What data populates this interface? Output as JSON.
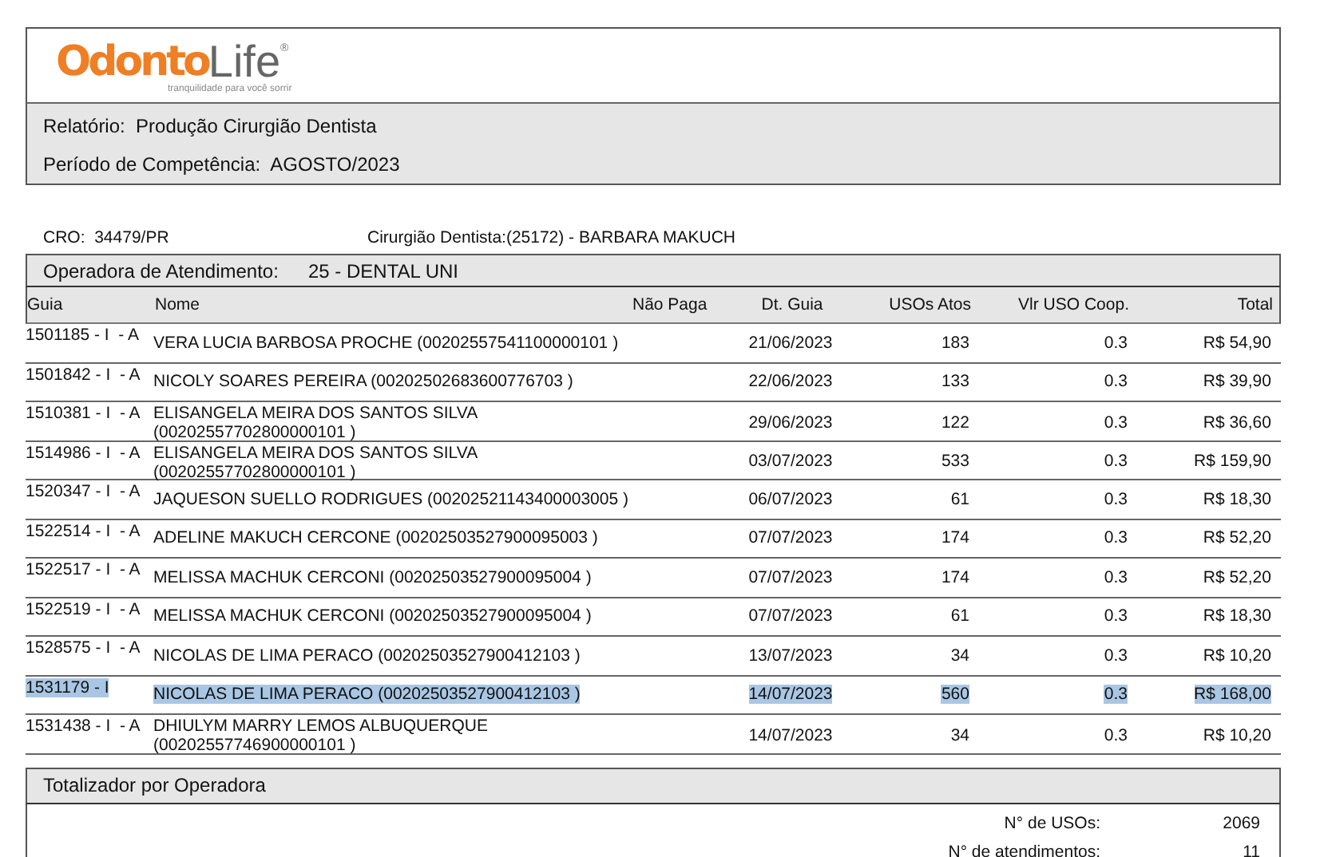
{
  "logo": {
    "brand_main": "Odonto",
    "brand_accent": "Life",
    "registered": "®",
    "tagline": "tranquilidade para você sorrir"
  },
  "header": {
    "report_label": "Relatório:",
    "report_value": "Produção Cirurgião Dentista",
    "period_label": "Período de Competência:",
    "period_value": "AGOSTO/2023"
  },
  "info": {
    "cro_label": "CRO:",
    "cro_value": "34479/PR",
    "dentist_label": "Cirurgião Dentista:",
    "dentist_value": "(25172) - BARBARA MAKUCH"
  },
  "operator": {
    "label": "Operadora de Atendimento:",
    "value": "25 - DENTAL UNI"
  },
  "table": {
    "columns": [
      "Guia",
      "Nome",
      "Não Paga",
      "Dt. Guia",
      "USOs Atos",
      "Vlr USO Coop.",
      "Total"
    ],
    "rows": [
      {
        "guia": "1501185 - I  - A",
        "nome": "VERA LUCIA BARBOSA PROCHE (00202557541100000101 )",
        "data": "21/06/2023",
        "usos": "183",
        "vlr": "0.3",
        "total": "R$ 54,90",
        "selected": false
      },
      {
        "guia": "1501842 - I  - A",
        "nome": "NICOLY SOARES PEREIRA (00202502683600776703 )",
        "data": "22/06/2023",
        "usos": "133",
        "vlr": "0.3",
        "total": "R$ 39,90",
        "selected": false
      },
      {
        "guia": "1510381 - I  - A",
        "nome": "ELISANGELA MEIRA DOS SANTOS SILVA (00202557702800000101 )",
        "data": "29/06/2023",
        "usos": "122",
        "vlr": "0.3",
        "total": "R$ 36,60",
        "selected": false
      },
      {
        "guia": "1514986 - I  - A",
        "nome": "ELISANGELA MEIRA DOS SANTOS SILVA (00202557702800000101 )",
        "data": "03/07/2023",
        "usos": "533",
        "vlr": "0.3",
        "total": "R$ 159,90",
        "selected": false
      },
      {
        "guia": "1520347 - I  - A",
        "nome": "JAQUESON SUELLO RODRIGUES (00202521143400003005 )",
        "data": "06/07/2023",
        "usos": "61",
        "vlr": "0.3",
        "total": "R$ 18,30",
        "selected": false
      },
      {
        "guia": "1522514 - I  - A",
        "nome": "ADELINE MAKUCH CERCONE (00202503527900095003 )",
        "data": "07/07/2023",
        "usos": "174",
        "vlr": "0.3",
        "total": "R$ 52,20",
        "selected": false
      },
      {
        "guia": "1522517 - I  - A",
        "nome": "MELISSA MACHUK CERCONI (00202503527900095004 )",
        "data": "07/07/2023",
        "usos": "174",
        "vlr": "0.3",
        "total": "R$ 52,20",
        "selected": false
      },
      {
        "guia": "1522519 - I  - A",
        "nome": "MELISSA MACHUK CERCONI (00202503527900095004 )",
        "data": "07/07/2023",
        "usos": "61",
        "vlr": "0.3",
        "total": "R$ 18,30",
        "selected": false
      },
      {
        "guia": "1528575 - I  - A",
        "nome": "NICOLAS DE LIMA PERACO (00202503527900412103 )",
        "data": "13/07/2023",
        "usos": "34",
        "vlr": "0.3",
        "total": "R$ 10,20",
        "selected": false
      },
      {
        "guia": "1531179 - I",
        "nome": "NICOLAS DE LIMA PERACO (00202503527900412103 )",
        "data": "14/07/2023",
        "usos": "560",
        "vlr": "0.3",
        "total": "R$ 168,00",
        "selected": true
      },
      {
        "guia": "1531438 - I  - A",
        "nome": "DHIULYM MARRY LEMOS ALBUQUERQUE (00202557746900000101 )",
        "data": "14/07/2023",
        "usos": "34",
        "vlr": "0.3",
        "total": "R$ 10,20",
        "selected": false
      }
    ]
  },
  "totals": {
    "title": "Totalizador por Operadora",
    "lines": [
      {
        "label": "N° de USOs:",
        "value": "2069"
      },
      {
        "label": "N° de atendimentos:",
        "value": "11"
      }
    ]
  }
}
